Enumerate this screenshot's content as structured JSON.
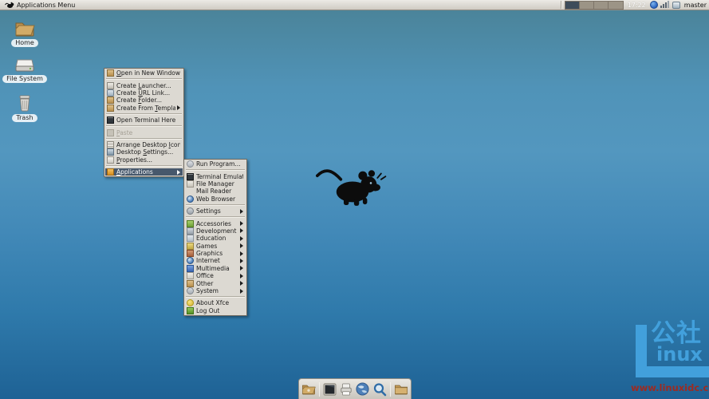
{
  "panel": {
    "menu_button_label": "Applications Menu",
    "clock": "17:22",
    "username": "master",
    "workspace_count": 4,
    "active_workspace": 1
  },
  "desktop_icons": [
    {
      "label": "Home",
      "icon": "home-folder"
    },
    {
      "label": "File System",
      "icon": "file-system-drive"
    },
    {
      "label": "Trash",
      "icon": "trash-can"
    }
  ],
  "context_menu": {
    "items": [
      {
        "label": "Open in New Window",
        "icon": "open-window",
        "u": 0
      },
      {
        "sep": true
      },
      {
        "label": "Create Launcher...",
        "icon": "create-launcher",
        "u": 7
      },
      {
        "label": "Create URL Link...",
        "icon": "create-url-link",
        "u": 7
      },
      {
        "label": "Create Folder...",
        "icon": "create-folder",
        "u": 7
      },
      {
        "label": "Create From Template",
        "icon": "create-template",
        "u": 12,
        "submenu": true
      },
      {
        "sep": true
      },
      {
        "label": "Open Terminal Here",
        "icon": "terminal"
      },
      {
        "sep": true
      },
      {
        "label": "Paste",
        "icon": "paste",
        "u": 0,
        "disabled": true
      },
      {
        "sep": true
      },
      {
        "label": "Arrange Desktop Icons",
        "icon": "arrange-icons",
        "u": 16
      },
      {
        "label": "Desktop Settings...",
        "icon": "desktop-settings",
        "u": 8
      },
      {
        "label": "Properties...",
        "icon": "properties",
        "u": 0
      },
      {
        "sep": true
      },
      {
        "label": "Applications",
        "icon": "applications",
        "u": 0,
        "submenu": true,
        "active": true
      }
    ]
  },
  "app_submenu": {
    "items": [
      {
        "label": "Run Program...",
        "icon": "run-program"
      },
      {
        "sep": true
      },
      {
        "label": "Terminal Emulator",
        "icon": "terminal"
      },
      {
        "label": "File Manager",
        "icon": "file-manager"
      },
      {
        "label": "Mail Reader",
        "icon": "none"
      },
      {
        "label": "Web Browser",
        "icon": "web-browser"
      },
      {
        "sep": true
      },
      {
        "label": "Settings",
        "icon": "settings",
        "submenu": true
      },
      {
        "sep": true
      },
      {
        "label": "Accessories",
        "icon": "accessories",
        "submenu": true
      },
      {
        "label": "Development",
        "icon": "development",
        "submenu": true
      },
      {
        "label": "Education",
        "icon": "education",
        "submenu": true
      },
      {
        "label": "Games",
        "icon": "games",
        "submenu": true
      },
      {
        "label": "Graphics",
        "icon": "graphics",
        "submenu": true
      },
      {
        "label": "Internet",
        "icon": "internet",
        "submenu": true
      },
      {
        "label": "Multimedia",
        "icon": "multimedia",
        "submenu": true
      },
      {
        "label": "Office",
        "icon": "office",
        "submenu": true
      },
      {
        "label": "Other",
        "icon": "other",
        "submenu": true
      },
      {
        "label": "System",
        "icon": "system",
        "submenu": true
      },
      {
        "sep": true
      },
      {
        "label": "About Xfce",
        "icon": "about-xfce"
      },
      {
        "label": "Log Out",
        "icon": "log-out"
      }
    ]
  },
  "dock": {
    "items": [
      "home-directory",
      "separator",
      "terminal",
      "print-files",
      "web-browser",
      "application-finder",
      "separator",
      "folder"
    ]
  },
  "watermark": {
    "big_letter": "L",
    "cn": "公社",
    "latin": "inux",
    "url": "www.linuxidc.com"
  },
  "colors": {
    "desktop_top": "#4a8296",
    "desktop_mid": "#5397bf",
    "desktop_bottom": "#1e6295",
    "panel_bg": "#d8d4cc",
    "menu_bg": "#dcd9d2",
    "menu_highlight": "#47586c",
    "watermark_blue": "#42a0dc",
    "watermark_red": "#9c2b22"
  }
}
